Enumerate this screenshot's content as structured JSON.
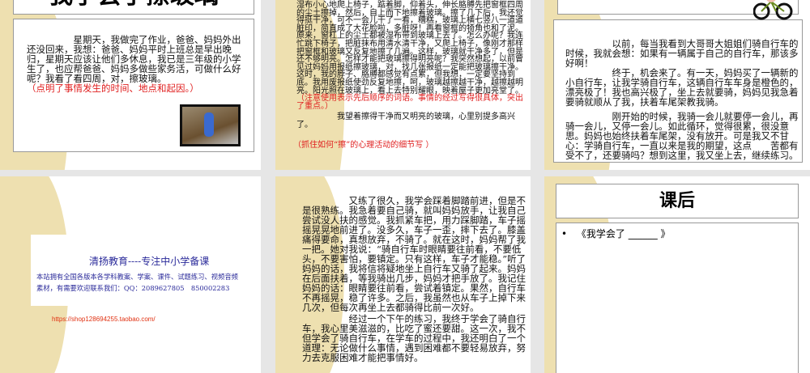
{
  "slides": [
    {
      "title": "我学会了擦玻璃",
      "body": "星期天，我做完了作业，爸爸、妈妈外出还没回来，我想：爸爸、妈妈平时上班总是早出晚归，星期天应该让他们多休息，我已是三年级的小学生了，也应帮爸爸、妈妈多做些家务活，可做什么好呢？我看了看四周，对，擦玻璃。",
      "note": "（点明了事情发生的时间、地点和起因。）"
    },
    {
      "body": "湿布小心地爬上椅子，踮着脚，仰着头，伸长胳膊先把窗框四周的尘土擦掉，然后，自上而下地擦着玻璃。擦了几下后，我还觉得挺干净，可不一会儿干了一看，糟糕，玻璃上横七竖八一道道脏印，简直成了大花脸啦，多脏呀！再看窗框的犄角也和了泥。原来，窗杠上的尘土都被湿布带到玻璃上去了。怎么办呢？我连忙跳下椅子，把脏抹布用清水清干净，又爬上椅子，像刚才那样把窗框和玻璃又反复地擦了几遍。这样，玻璃就干净多了，但是还不够明亮。怎样才能把玻璃擦得明亮呢？我突然想起，以前曾见过妈妈用报纸擦玻璃，对，找几张报纸一定能把玻璃擦干净。这时，我的脖子、胳膊都感觉有点累，但我想，一定要坚持到底。我用废报纸使劲反复地擦，呵，玻璃越擦越干净，越擦越明亮。阳光照在玻璃上，看上去特别耀眼，映着屋子更加亮堂了。",
      "note1": "（注意使用表示先后顺序的词语。事情的经过写得很具体，突出了重点。）",
      "body2": "我望着擦得干净而又明亮的玻璃，心里别提多高兴了。",
      "note2": "（抓住如何“擦”的心理活动的细节写 ）"
    },
    {
      "p1": "以前，每当我看到大哥哥大姐姐们骑自行车的时候，我就会想：如果有一辆属于自己的自行车，那该多好啊！",
      "p2": "终于，机会来了。有一天，妈妈买了一辆新的小自行车，让我学骑自行车，这辆自行车车身是橙色的，漂亮极了！我也高兴极了，坐上去就要骑，妈妈见我急着要骑就顺从了我，扶着车尾架教我骑。",
      "p3": "刚开始的时候，我骑一会儿就要停一会儿，再骑一会儿，又停一会儿。如此循环，觉得很累，很没意思。妈妈也始终扶着车尾架，没有放开。可是我又不甘心：学骑自行车，一直以来是我的期望，这点　　苦都有受不了，还要骑吗？想到这里，我又坐上去，继续练习。"
    },
    {
      "heading": "清扬教育----专注中小学备课",
      "line1": "本站拥有全国各版本各学科教案、学案、课件、试题练习、视频音频",
      "line2": "素材，有需要欢迎联系我们：QQ：2089627805　850002283",
      "url": "https://shop128694255.taobao.com/"
    },
    {
      "p1": "又练了很久，我学会踩着脚踏前进，但是不是很熟练。我急着要自己骑，就叫妈妈放手，让我自己尝试没人扶的感觉。我抓紧车把，用力踩脚踏，车子摇摇晃晃地前进了。没多久，车子一歪，摔下去了。膝盖痛得要命，真想放弃，不骑了。就在这时，妈妈帮了我一把。她对我说：“骑自行车时眼睛要往前看，不要低头，不要害怕，要镇定。只有这样，车子才能稳。”听了妈妈的话，我将信将疑地坐上自行车又骑了起来。妈妈在后面扶着，等我骑出几步，妈妈才把手放了。我记住妈妈的话：眼睛要往前看，尝试着镇定。果然，自行车不再摇晃，稳了许多。之后，我虽然也从车子上掉下来几次，但每次再坐上去都骑得比前一次好。",
      "p2": "经过一个下午的练习，我终于学会了骑自行车，我心里美滋滋的，比吃了蜜还要甜。这一次，我不但学会了骑自行车，在学车的过程中，我还明白了一个道理：无论做什么事情，遇到困难都不要轻易放弃，努力去克服困难才能把事情好。"
    },
    {
      "title": "课后",
      "bullet": "《我学会了 ______ 》"
    }
  ]
}
